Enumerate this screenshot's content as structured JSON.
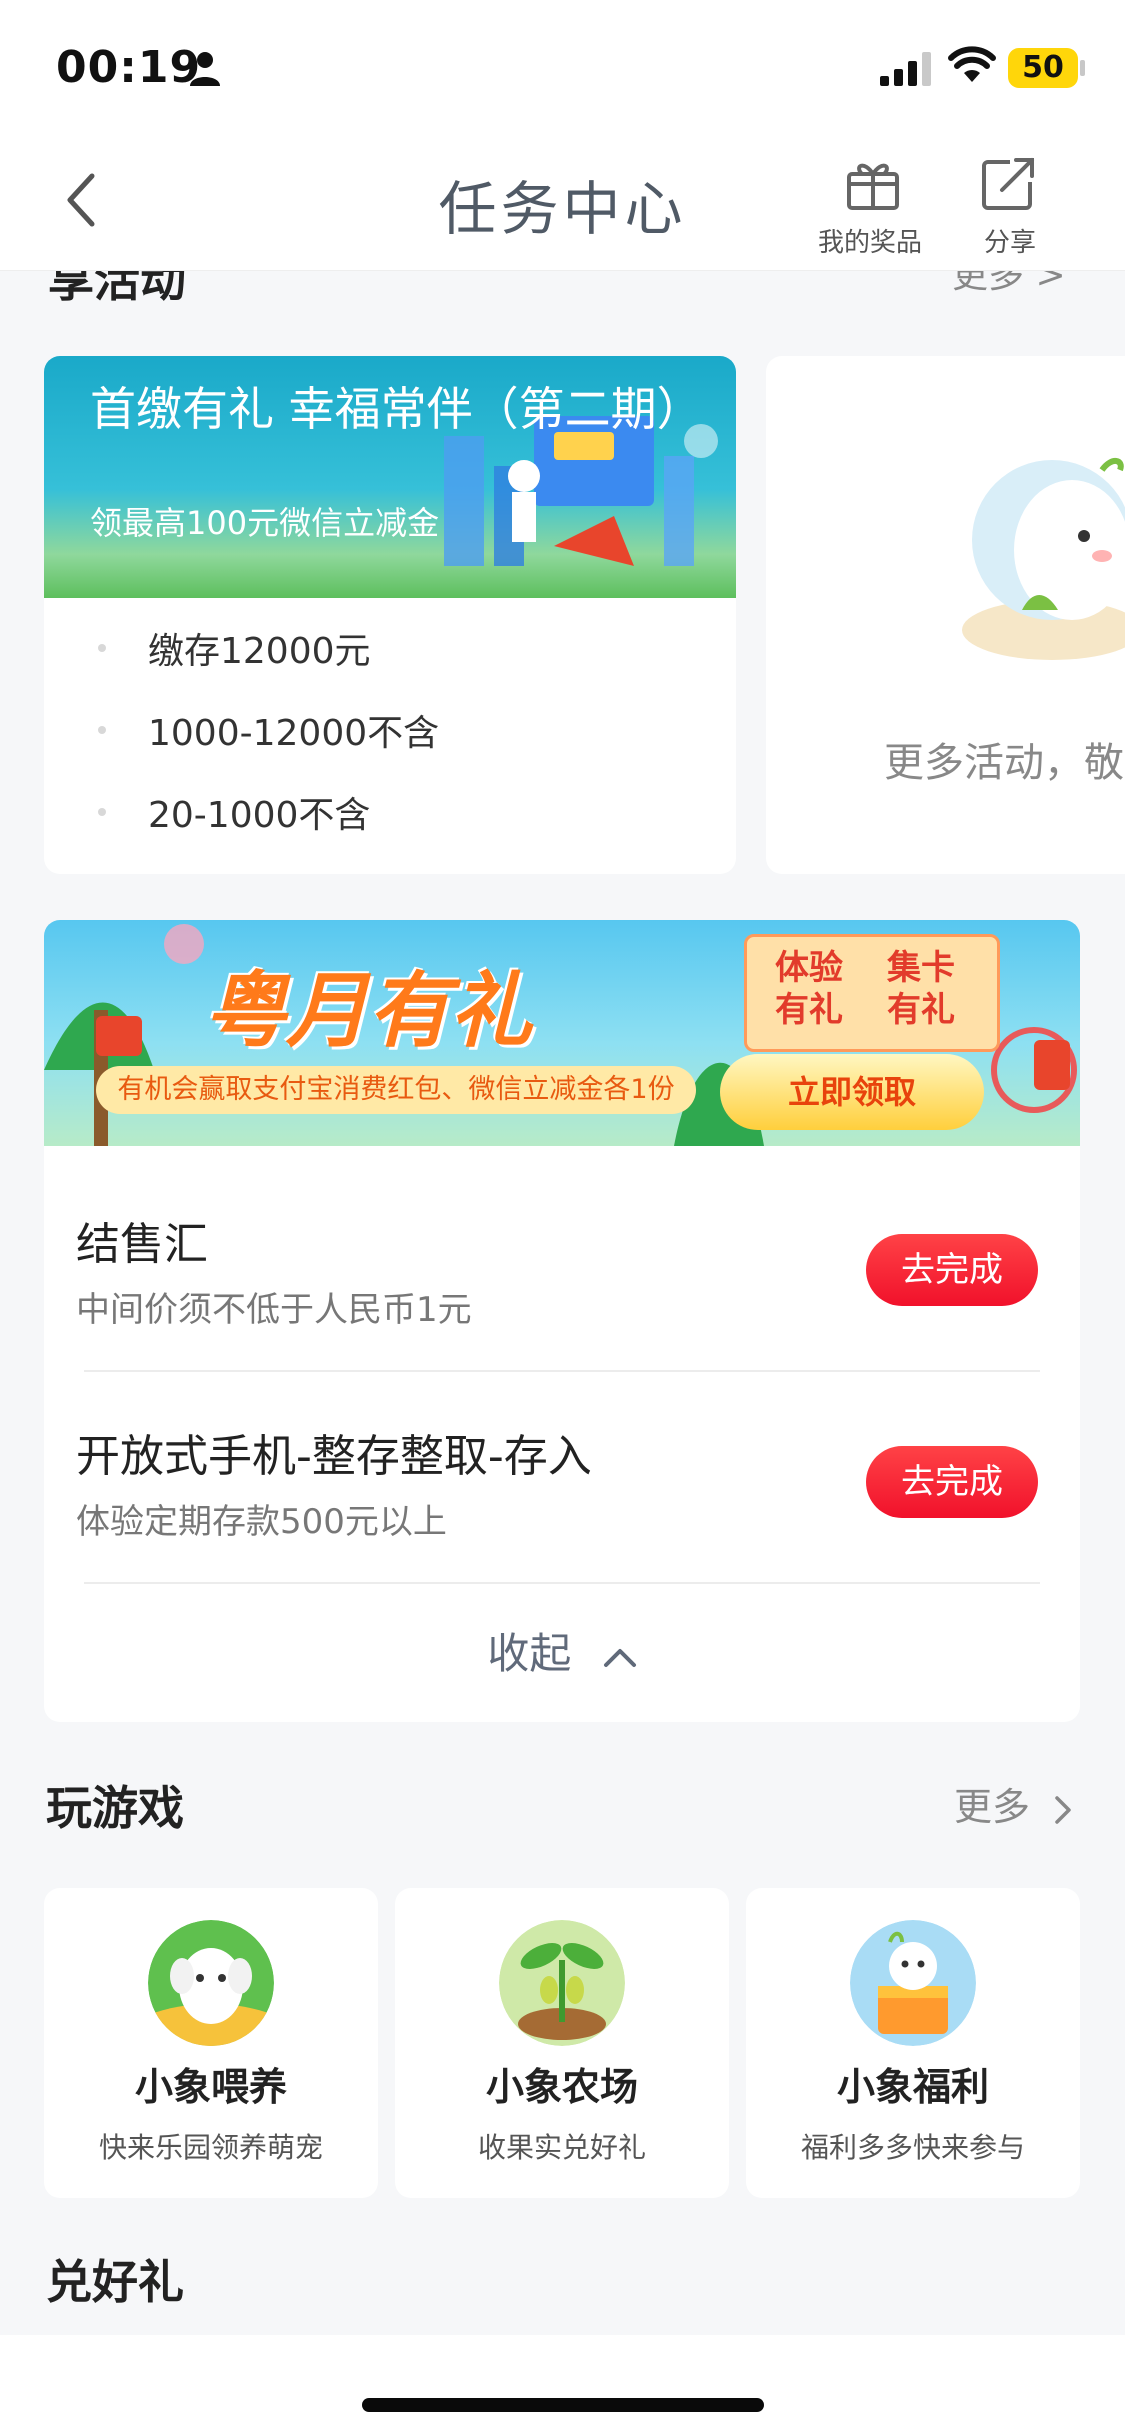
{
  "status_bar": {
    "time": "00:19",
    "battery": "50"
  },
  "nav": {
    "title": "任务中心",
    "prizes_label": "我的奖品",
    "share_label": "分享"
  },
  "activities_section": {
    "title_cut": "享活动",
    "more_label": "更多 >"
  },
  "activity_card": {
    "title": "首缴有礼 幸福常伴（第二期）",
    "subtitle": "领最高100元微信立减金",
    "items": [
      "缴存12000元",
      "1000-12000不含",
      "20-1000不含"
    ]
  },
  "more_card": {
    "text": "更多活动，敬"
  },
  "promo": {
    "title": "粤月有礼",
    "subtitle": "有机会赢取支付宝消费红包、微信立减金各1份",
    "badge_left": "体验有礼",
    "badge_right": "集卡有礼",
    "button": "立即领取"
  },
  "tasks": [
    {
      "title": "结售汇",
      "desc": "中间价须不低于人民币1元",
      "button": "去完成"
    },
    {
      "title": "开放式手机-整存整取-存入",
      "desc": "体验定期存款500元以上",
      "button": "去完成"
    }
  ],
  "collapse_label": "收起",
  "games_section": {
    "title": "玩游戏",
    "more_label": "更多"
  },
  "games": [
    {
      "name": "小象喂养",
      "desc": "快来乐园领养萌宠",
      "icon": "elephant-feed-icon"
    },
    {
      "name": "小象农场",
      "desc": "收果实兑好礼",
      "icon": "bean-sprout-icon"
    },
    {
      "name": "小象福利",
      "desc": "福利多多快来参与",
      "icon": "elephant-gift-icon"
    }
  ],
  "exchange_section": {
    "title": "兑好礼"
  },
  "colors": {
    "accent_red": "#f1112b",
    "banner_blue": "#1aa9c9",
    "promo_orange": "#ff7a1a"
  }
}
